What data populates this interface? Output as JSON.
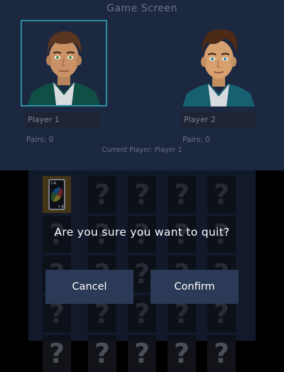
{
  "screen": {
    "title": "Game Screen"
  },
  "players": [
    {
      "name": "Player 1",
      "pairs_label": "Pairs: 0",
      "eye_color": "#3e8a3a"
    },
    {
      "name": "Player 2",
      "pairs_label": "Pairs: 0",
      "eye_color": "#2e7f8f"
    }
  ],
  "status": {
    "current_player": "Current Player: Player 1"
  },
  "board": {
    "rows": 5,
    "cols": 5,
    "hidden_symbol": "?",
    "revealed": [
      {
        "row": 0,
        "col": 0,
        "card": "uno-wild-draw-4"
      }
    ],
    "revealed_card_text": "+4"
  },
  "dialog": {
    "message": "Are you sure you want to quit?",
    "cancel_label": "Cancel",
    "confirm_label": "Confirm"
  },
  "colors": {
    "panel": "#1c2740",
    "active_player_frame": "#2a8ea0",
    "button": "#2b3a56",
    "revealed_card_bg": "#8c6512"
  }
}
